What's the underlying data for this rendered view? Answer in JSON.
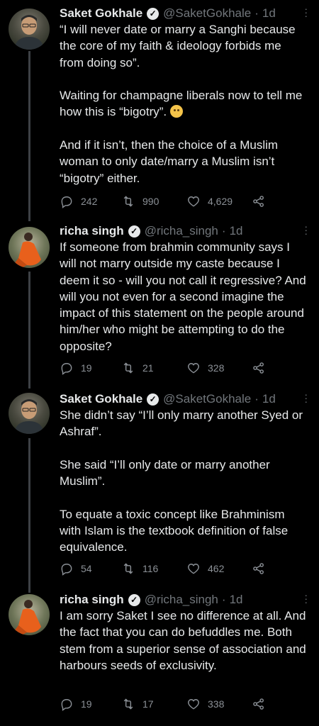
{
  "tweets": [
    {
      "name": "Saket Gokhale",
      "handle": "@SaketGokhale",
      "time": "1d",
      "text": "“I will never date or marry a Sanghi because the core of my faith & ideology forbids me from doing so”.\n\nWaiting for champagne liberals now to tell me how this is “bigotry”.",
      "text2": "\n\nAnd if it isn’t, then the choice of a Muslim woman to only date/marry a Muslim isn’t “bigotry” either.",
      "emoji": "face-with-rolling-eyes",
      "replies": "242",
      "retweets": "990",
      "likes": "4,629"
    },
    {
      "name": "richa singh",
      "handle": "@richa_singh",
      "time": "1d",
      "text": "If someone from brahmin community says I will not marry outside my caste because I deem it so - will you not call it regressive? And will you not even for a second imagine the impact of this statement on the people around him/her who might be attempting to do the opposite?",
      "replies": "19",
      "retweets": "21",
      "likes": "328"
    },
    {
      "name": "Saket Gokhale",
      "handle": "@SaketGokhale",
      "time": "1d",
      "text": "She didn’t say “I’ll only marry another Syed or Ashraf”.\n\nShe said “I’ll only date or marry another Muslim”.\n\nTo equate a toxic concept like Brahminism with Islam is the textbook definition of false equivalence.",
      "replies": "54",
      "retweets": "116",
      "likes": "462"
    },
    {
      "name": "richa singh",
      "handle": "@richa_singh",
      "time": "1d",
      "text": "I am sorry Saket I see no difference at all. And the fact that you can do befuddles me. Both stem from a superior sense of association and harbours seeds of exclusivity.",
      "replies": "19",
      "retweets": "17",
      "likes": "338"
    }
  ],
  "colors": {
    "background": "#000000",
    "text": "#e7e9ea",
    "muted": "#71767b",
    "thread_line": "#3d4145"
  },
  "icons": [
    "verified-icon",
    "more-icon",
    "reply-icon",
    "retweet-icon",
    "like-icon",
    "share-icon"
  ]
}
